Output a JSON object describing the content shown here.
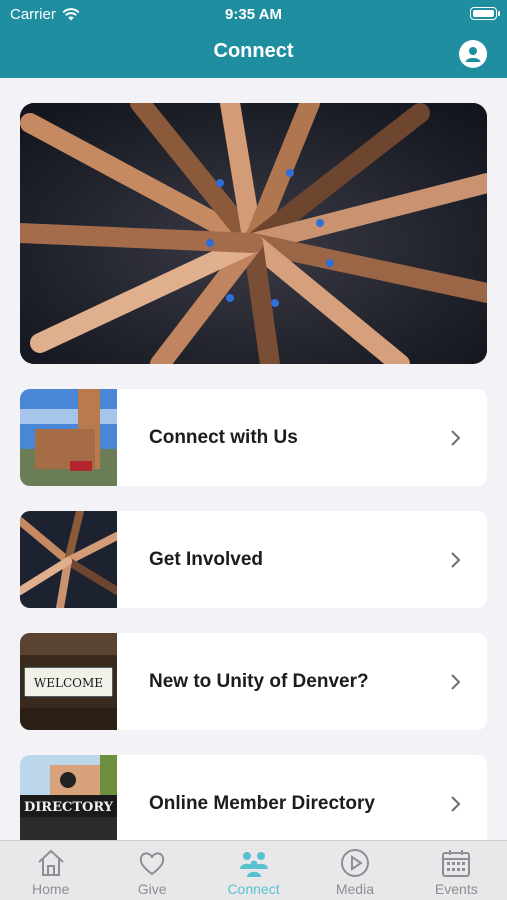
{
  "status_bar": {
    "carrier": "Carrier",
    "time": "9:35 AM"
  },
  "nav": {
    "title": "Connect"
  },
  "cards": [
    {
      "label": "Connect with Us"
    },
    {
      "label": "Get Involved"
    },
    {
      "label": "New to Unity of Denver?"
    },
    {
      "label": "Online Member Directory"
    }
  ],
  "thumb_text": {
    "welcome": "WELCOME",
    "directory": "DIRECTORY"
  },
  "tabs": [
    {
      "label": "Home",
      "icon": "home-icon"
    },
    {
      "label": "Give",
      "icon": "heart-icon"
    },
    {
      "label": "Connect",
      "icon": "people-icon",
      "active": true
    },
    {
      "label": "Media",
      "icon": "play-icon"
    },
    {
      "label": "Events",
      "icon": "calendar-icon"
    }
  ],
  "colors": {
    "header": "#1f8ea0",
    "active_tab": "#58c1cf",
    "inactive_tab": "#8e8e93"
  }
}
